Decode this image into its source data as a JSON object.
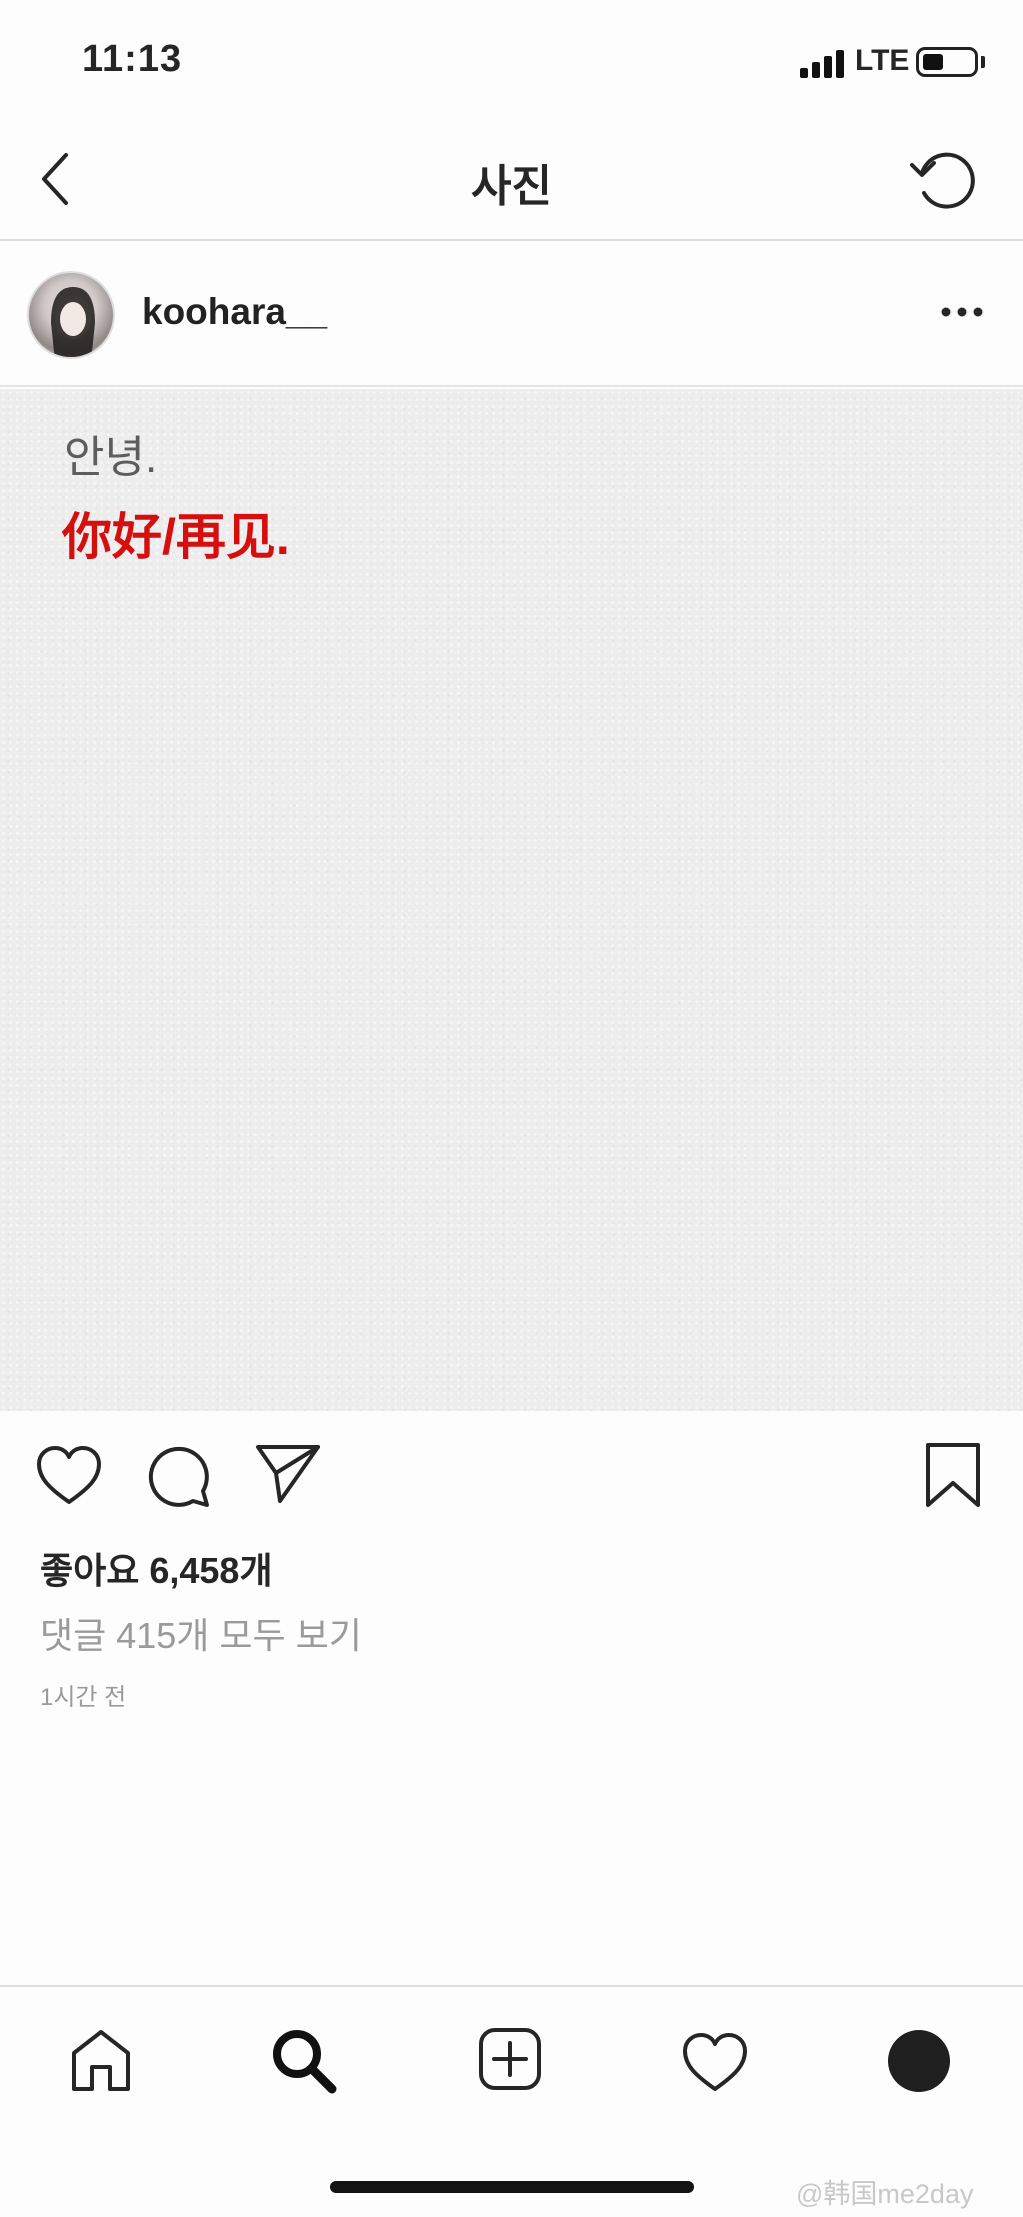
{
  "status_bar": {
    "time": "11:13",
    "network": "LTE"
  },
  "nav": {
    "title": "사진"
  },
  "post": {
    "username": "koohara__",
    "text_line1": "안녕.",
    "text_line2": "你好/再见.",
    "likes": "좋아요 6,458개",
    "comments_link": "댓글 415개 모두 보기",
    "timestamp": "1시간 전"
  },
  "icons": {
    "back": "chevron-left-icon",
    "refresh": "refresh-icon",
    "more": "more-horizontal-icon",
    "like": "heart-icon",
    "comment": "comment-icon",
    "share": "send-icon",
    "save": "bookmark-icon",
    "home": "home-icon",
    "search": "search-icon",
    "add": "add-post-icon",
    "activity": "heart-icon",
    "profile": "profile-icon"
  },
  "watermark": "@韩国me2day",
  "colors": {
    "caption_accent": "#d50e0e",
    "text": "#262626",
    "muted": "#9a9a9a"
  }
}
